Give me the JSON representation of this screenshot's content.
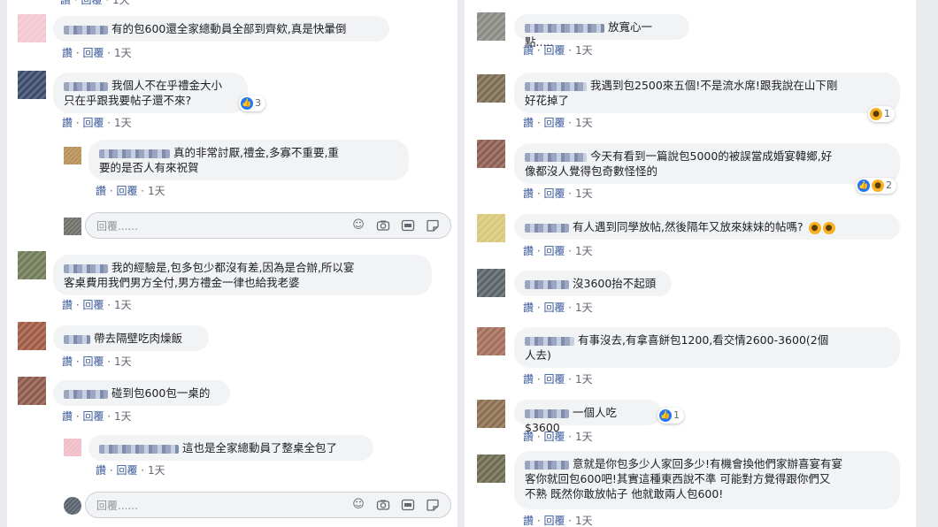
{
  "left_column": {
    "comments": [
      {
        "text": "有的包600還全家總動員全部到齊欸,真是快暈倒",
        "like": "讚",
        "reply": "回覆",
        "time": "1天",
        "avatar_color": "#f2c7cf"
      },
      {
        "text_line1": "我個人不在乎禮金大小",
        "text_line2": "只在乎跟我要帖子還不來?",
        "like": "讚",
        "reply": "回覆",
        "time": "1天",
        "reaction_count": "3",
        "avatar_color": "#3c4a6a"
      },
      {
        "text_line1": "真的非常討厭,禮金,多寡不重要,重",
        "text_line2": "要的是否人有來祝賀",
        "like": "讚",
        "reply": "回覆",
        "time": "1天",
        "avatar_color": "#b88d56"
      },
      {
        "text_line1": "我的經驗是,包多包少都沒有差,因為是合辦,所以宴",
        "text_line2": "客桌費用我們男方全付,男方禮金一律也給我老婆",
        "like": "讚",
        "reply": "回覆",
        "time": "1天",
        "avatar_color": "#6f7a57"
      },
      {
        "text": "帶去隔壁吃肉燥飯",
        "like": "讚",
        "reply": "回覆",
        "time": "1天",
        "avatar_color": "#a05a44"
      },
      {
        "text": "碰到包600包一桌的",
        "like": "讚",
        "reply": "回覆",
        "time": "1天",
        "avatar_color": "#8c5a4a"
      },
      {
        "text": "這也是全家總動員了整桌全包了",
        "like": "讚",
        "reply": "回覆",
        "time": "1天",
        "avatar_color": "#f0bcc6"
      }
    ],
    "reply_placeholder_1": "回覆......",
    "reply_placeholder_2": "回覆......",
    "reply_avatar_1_color": "#6b6f66",
    "reply_avatar_2_color": "#55606b"
  },
  "right_column": {
    "comments": [
      {
        "text": "放寬心一點.....",
        "like": "讚",
        "reply": "回覆",
        "time": "1天",
        "avatar_color": "#8a8a84"
      },
      {
        "text_line1": "我遇到包2500來五個!不是流水席!跟我說在山下剛",
        "text_line2": "好花掉了",
        "like": "讚",
        "reply": "回覆",
        "time": "1天",
        "reaction_count": "1",
        "avatar_color": "#7b6c52"
      },
      {
        "text_line1": "今天有看到一篇說包5000的被誤當成婚宴韓鄉,好",
        "text_line2": "像都沒人覺得包奇數怪怪的",
        "like": "讚",
        "reply": "回覆",
        "time": "1天",
        "reaction_count": "2",
        "avatar_color": "#8c5e52"
      },
      {
        "text": "有人遇到同學放帖,然後隔年又放來妹妹的帖嗎?",
        "like": "讚",
        "reply": "回覆",
        "time": "1天",
        "avatar_color": "#d8c878"
      },
      {
        "text": "沒3600抬不起頭",
        "like": "讚",
        "reply": "回覆",
        "time": "1天",
        "avatar_color": "#5a6366"
      },
      {
        "text_line1": "有事沒去,有拿喜餅包1200,看交情2600-3600(2個",
        "text_line2": "人去)",
        "like": "讚",
        "reply": "回覆",
        "time": "1天",
        "avatar_color": "#a46e5a"
      },
      {
        "text": "一個人吃$3600",
        "like": "讚",
        "reply": "回覆",
        "time": "1天",
        "reaction_count": "1",
        "avatar_color": "#8b6e50"
      },
      {
        "text_line1": "意就是你包多少人家回多少!有機會換他們家辦喜宴有宴",
        "text_line2": "客你就回包600吧!其實這種東西說不準 可能對方覺得跟你們又",
        "text_line3": "不熟 既然你敢放帖子 他就敢兩人包600!",
        "like": "讚",
        "reply": "回覆",
        "time": "1天",
        "avatar_color": "#6d6a4f"
      }
    ]
  },
  "colors": {
    "link": "#385898",
    "bubble": "#f2f3f5",
    "like_blue": "#2078f4",
    "background": "#e9ebee"
  }
}
